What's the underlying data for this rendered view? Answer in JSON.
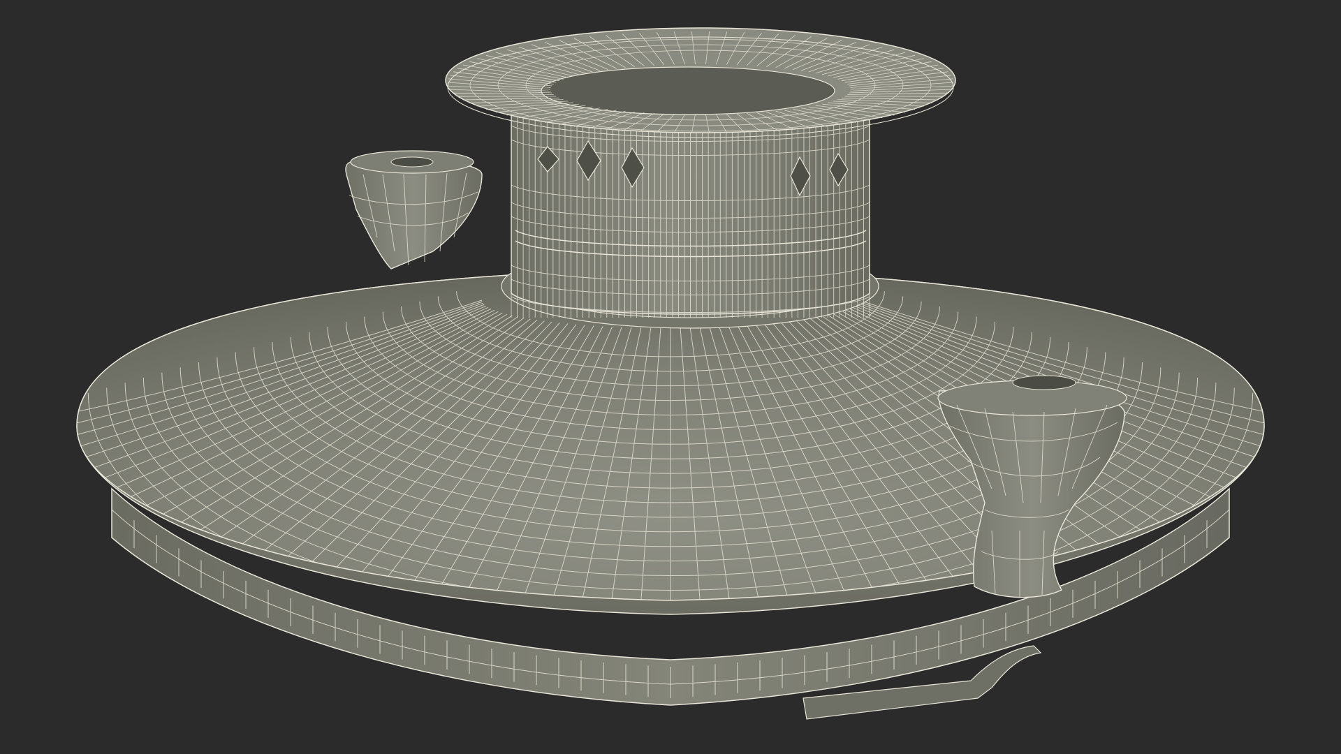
{
  "scene": {
    "subject": "lid-with-knobs-wireframe",
    "render_style": "wireframe-over-shaded",
    "colors": {
      "background": "#2b2b2b",
      "surface_light": "#8e8f84",
      "surface_mid": "#7b7c71",
      "surface_dark": "#63645a",
      "wire": "#e8e6d8"
    }
  }
}
